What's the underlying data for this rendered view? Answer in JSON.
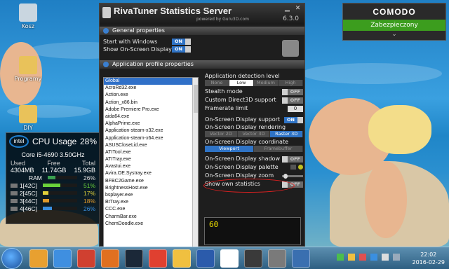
{
  "desktop": {
    "icons": [
      {
        "label": "Kosz",
        "color": "#c9d6e0"
      },
      {
        "label": "Programy",
        "color": "#e9c25a"
      },
      {
        "label": "DIY",
        "color": "#e9c25a"
      }
    ]
  },
  "comodo": {
    "brand": "COMODO",
    "status": "Zabezpieczony",
    "chevron": "⌄",
    "status_color": "#3c9d1e"
  },
  "cpu_widget": {
    "title": "CPU Usage",
    "usage": "28%",
    "logo_text": "intel",
    "model": "Core i5-4690 3.50GHz",
    "mem_headers": [
      "Used",
      "Free",
      "Total"
    ],
    "mem_values": [
      "4304MB",
      "11.74GB",
      "15.9GB"
    ],
    "ram_label": "RAM",
    "ram_pct": "26%",
    "ram_fill": 0.26,
    "cores": [
      {
        "label": "1[42C]",
        "pct": "51%",
        "fill": 0.51,
        "color": "#6ad13a"
      },
      {
        "label": "2[45C]",
        "pct": "17%",
        "fill": 0.17,
        "color": "#e0d03a"
      },
      {
        "label": "3[44C]",
        "pct": "18%",
        "fill": 0.18,
        "color": "#e09a2a"
      },
      {
        "label": "4[46C]",
        "pct": "26%",
        "fill": 0.26,
        "color": "#3a8fe0"
      }
    ]
  },
  "rivatuner": {
    "title": "RivaTuner Statistics Server",
    "subtitle": "powered by Guru3D.com",
    "version": "6.3.0",
    "general_header": "General properties",
    "start_with_windows": {
      "label": "Start with Windows",
      "state": "ON"
    },
    "show_osd": {
      "label": "Show On-Screen Display",
      "state": "ON"
    },
    "profile_header": "Application profile properties",
    "apps": [
      "Global",
      "AcroRd32.exe",
      "Action.exe",
      "Action_x86.bin",
      "Adobe Premiere Pro.exe",
      "aida64.exe",
      "AlphaPrime.exe",
      "Application-steam-x32.exe",
      "Application-steam-x64.exe",
      "ASUSCloseLid.exe",
      "ATITool.exe",
      "ATITray.exe",
      "Avastui.exe",
      "Avira.OE.Systray.exe",
      "BFBC2Game.exe",
      "BrightnessHost.exe",
      "bsplayer.exe",
      "BtTray.exe",
      "CCC.exe",
      "CharmBar.exe",
      "ChemDoodle.exe"
    ],
    "selected_app": "Global",
    "detection_label": "Application detection level",
    "detection_levels": [
      "None",
      "Low",
      "Medium",
      "High"
    ],
    "detection_selected": "Low",
    "stealth": {
      "label": "Stealth mode",
      "state": "OFF"
    },
    "custom_d3d": {
      "label": "Custom Direct3D support",
      "state": "OFF"
    },
    "framerate": {
      "label": "Framerate limit",
      "value": "0"
    },
    "osd_support": {
      "label": "On-Screen Display support",
      "state": "ON"
    },
    "rendering_label": "On-Screen Display rendering mode",
    "rendering_modes": [
      "Vector 2D",
      "Vector 3D",
      "Raster 3D"
    ],
    "rendering_selected": "Raster 3D",
    "coord_label": "On-Screen Display coordinate space",
    "coord_modes": [
      "Viewport",
      "Framebuffer"
    ],
    "coord_selected": "Viewport",
    "shadow": {
      "label": "On-Screen Display shadow",
      "state": "OFF"
    },
    "palette": {
      "label": "On-Screen Display palette"
    },
    "zoom": {
      "label": "On-Screen Display zoom"
    },
    "own_stats": {
      "label": "Show own statistics",
      "state": "OFF"
    },
    "preview_text": "60"
  },
  "taskbar": {
    "apps": [
      {
        "name": "multimedia-icon",
        "color": "#e8a030"
      },
      {
        "name": "windows-icon",
        "color": "#3f8fe0"
      },
      {
        "name": "cleaner-icon",
        "color": "#d04030"
      },
      {
        "name": "browser-icon",
        "color": "#e07020"
      },
      {
        "name": "steam-icon",
        "color": "#1b2838"
      },
      {
        "name": "chrome-icon",
        "color": "#e04030"
      },
      {
        "name": "folder-icon",
        "color": "#f0c040"
      },
      {
        "name": "word-icon",
        "color": "#2b5bab"
      },
      {
        "name": "panda-icon",
        "color": "#ffffff"
      },
      {
        "name": "csgo-icon",
        "color": "#3a3a3a"
      },
      {
        "name": "tool-icon",
        "color": "#7a7a7a"
      },
      {
        "name": "monitor-icon",
        "color": "#3a6fb0"
      }
    ],
    "time": "22:02",
    "date": "2016-02-29"
  }
}
